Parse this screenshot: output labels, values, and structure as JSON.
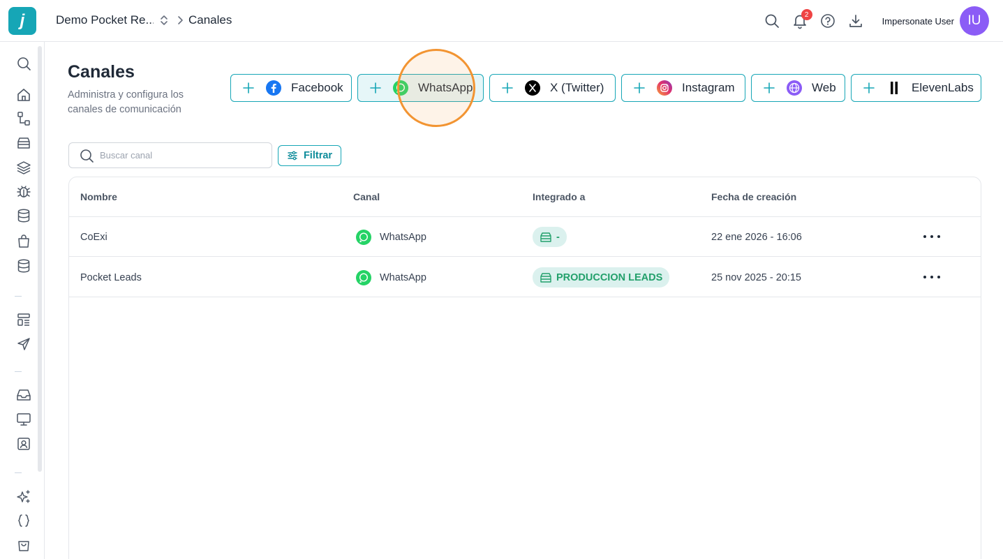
{
  "header": {
    "org_name": "Demo Pocket Re...",
    "page": "Canales",
    "notifications_count": "2",
    "user_name": "Impersonate User",
    "avatar_initials": "IU"
  },
  "icons": {
    "logo": "j",
    "topbar": [
      "search-icon",
      "bell-icon",
      "help-icon",
      "download-icon"
    ],
    "sidebar": [
      "search-icon",
      "home-icon",
      "flow-icon",
      "archive-icon",
      "layers-icon",
      "bug-icon",
      "database-icon",
      "bag-icon",
      "database-icon",
      "layout-icon",
      "send-icon",
      "inbox-icon",
      "monitor-icon",
      "contact-icon",
      "sparkles-icon",
      "braces-icon",
      "store-icon"
    ]
  },
  "page": {
    "title": "Canales",
    "subtitle": "Administra y configura los canales de comunicación"
  },
  "channels": [
    {
      "label": "Facebook",
      "icon": "facebook-icon",
      "color": "#1877f2"
    },
    {
      "label": "WhatsApp",
      "icon": "whatsapp-icon",
      "color": "#25d366"
    },
    {
      "label": "X (Twitter)",
      "icon": "x-twitter-icon",
      "color": "#000000"
    },
    {
      "label": "Instagram",
      "icon": "instagram-icon",
      "color": "#e1306c"
    },
    {
      "label": "Web",
      "icon": "globe-icon",
      "color": "#8b5cf6"
    },
    {
      "label": "ElevenLabs",
      "icon": "elevenlabs-icon",
      "color": "#000000"
    }
  ],
  "search": {
    "placeholder": "Buscar canal"
  },
  "filter": {
    "label": "Filtrar"
  },
  "table": {
    "columns": [
      "Nombre",
      "Canal",
      "Integrado a",
      "Fecha de creación"
    ],
    "rows": [
      {
        "name": "CoExi",
        "channel": "WhatsApp",
        "integrated": "-",
        "created": "22 ene 2026 - 16:06"
      },
      {
        "name": "Pocket Leads",
        "channel": "WhatsApp",
        "integrated": "PRODUCCION LEADS",
        "created": "25 nov 2025 - 20:15"
      }
    ]
  },
  "colors": {
    "accent": "#16a6b6",
    "highlight_ring": "#f29432",
    "tag_bg": "#dbf1ee",
    "tag_text": "#22a06b"
  }
}
